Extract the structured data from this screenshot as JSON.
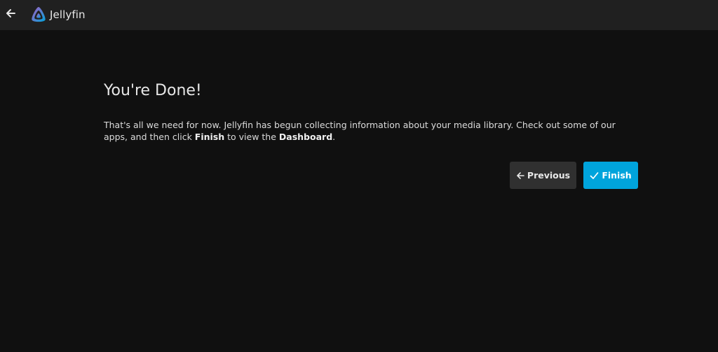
{
  "header": {
    "back_icon": "arrow-left-icon",
    "logo_icon": "jellyfin-logo-icon",
    "app_name": "Jellyfin"
  },
  "main": {
    "title": "You're Done!",
    "description": {
      "part1": "That's all we need for now. Jellyfin has begun collecting information about your media library. Check out some of our apps, and then click ",
      "bold1": "Finish",
      "part2": " to view the ",
      "bold2": "Dashboard",
      "part3": "."
    }
  },
  "buttons": {
    "previous_label": "Previous",
    "previous_icon": "arrow-left-icon",
    "finish_label": "Finish",
    "finish_icon": "check-icon"
  },
  "colors": {
    "accent": "#00a4dc",
    "background": "#101010",
    "header": "#202020"
  }
}
